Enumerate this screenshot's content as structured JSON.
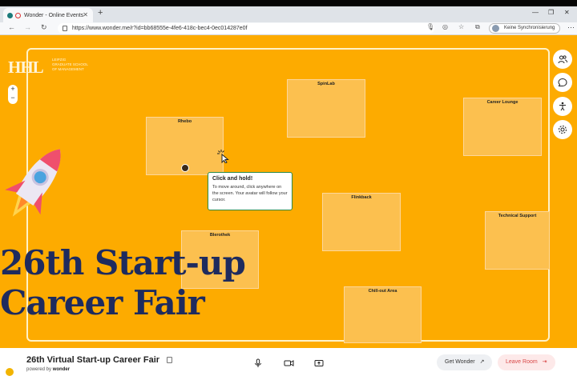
{
  "browser": {
    "tab_title": "Wonder - Online Events",
    "url": "https://www.wonder.me/r?id=bb68555e-4fe6-418c-bec4-0ec014287e0f",
    "sync_label": "Keine Synchronisierung"
  },
  "logo": {
    "mark": "HHL",
    "line1": "LEIPZIG",
    "line2": "GRADUATE SCHOOL",
    "line3": "OF MANAGEMENT"
  },
  "rooms": [
    {
      "name": "SpinLab"
    },
    {
      "name": "Career Lounge"
    },
    {
      "name": "Rhebo"
    },
    {
      "name": "Flinkback"
    },
    {
      "name": "Technical Support"
    },
    {
      "name": "Blerothek"
    },
    {
      "name": "Chill-out Area"
    }
  ],
  "headline": {
    "line1": "26th Start-up",
    "line2": "Career Fair"
  },
  "tooltip": {
    "title": "Click and hold!",
    "body": "To move around, click anywhere on the screen. Your avatar will follow your cursor."
  },
  "footer": {
    "event_title": "26th Virtual Start-up Career Fair",
    "powered_prefix": "powered by",
    "powered_brand": "wonder",
    "get_wonder": "Get Wonder",
    "leave_room": "Leave Room"
  },
  "colors": {
    "stage": "#fdab00",
    "room": "#fcc04f",
    "headline": "#1e2b5e",
    "leave": "#d94848"
  },
  "icons": [
    "people-icon",
    "chat-icon",
    "accessibility-icon",
    "settings-icon",
    "microphone-icon",
    "camera-icon",
    "screen-share-icon",
    "external-link-icon",
    "exit-icon",
    "copy-icon"
  ]
}
